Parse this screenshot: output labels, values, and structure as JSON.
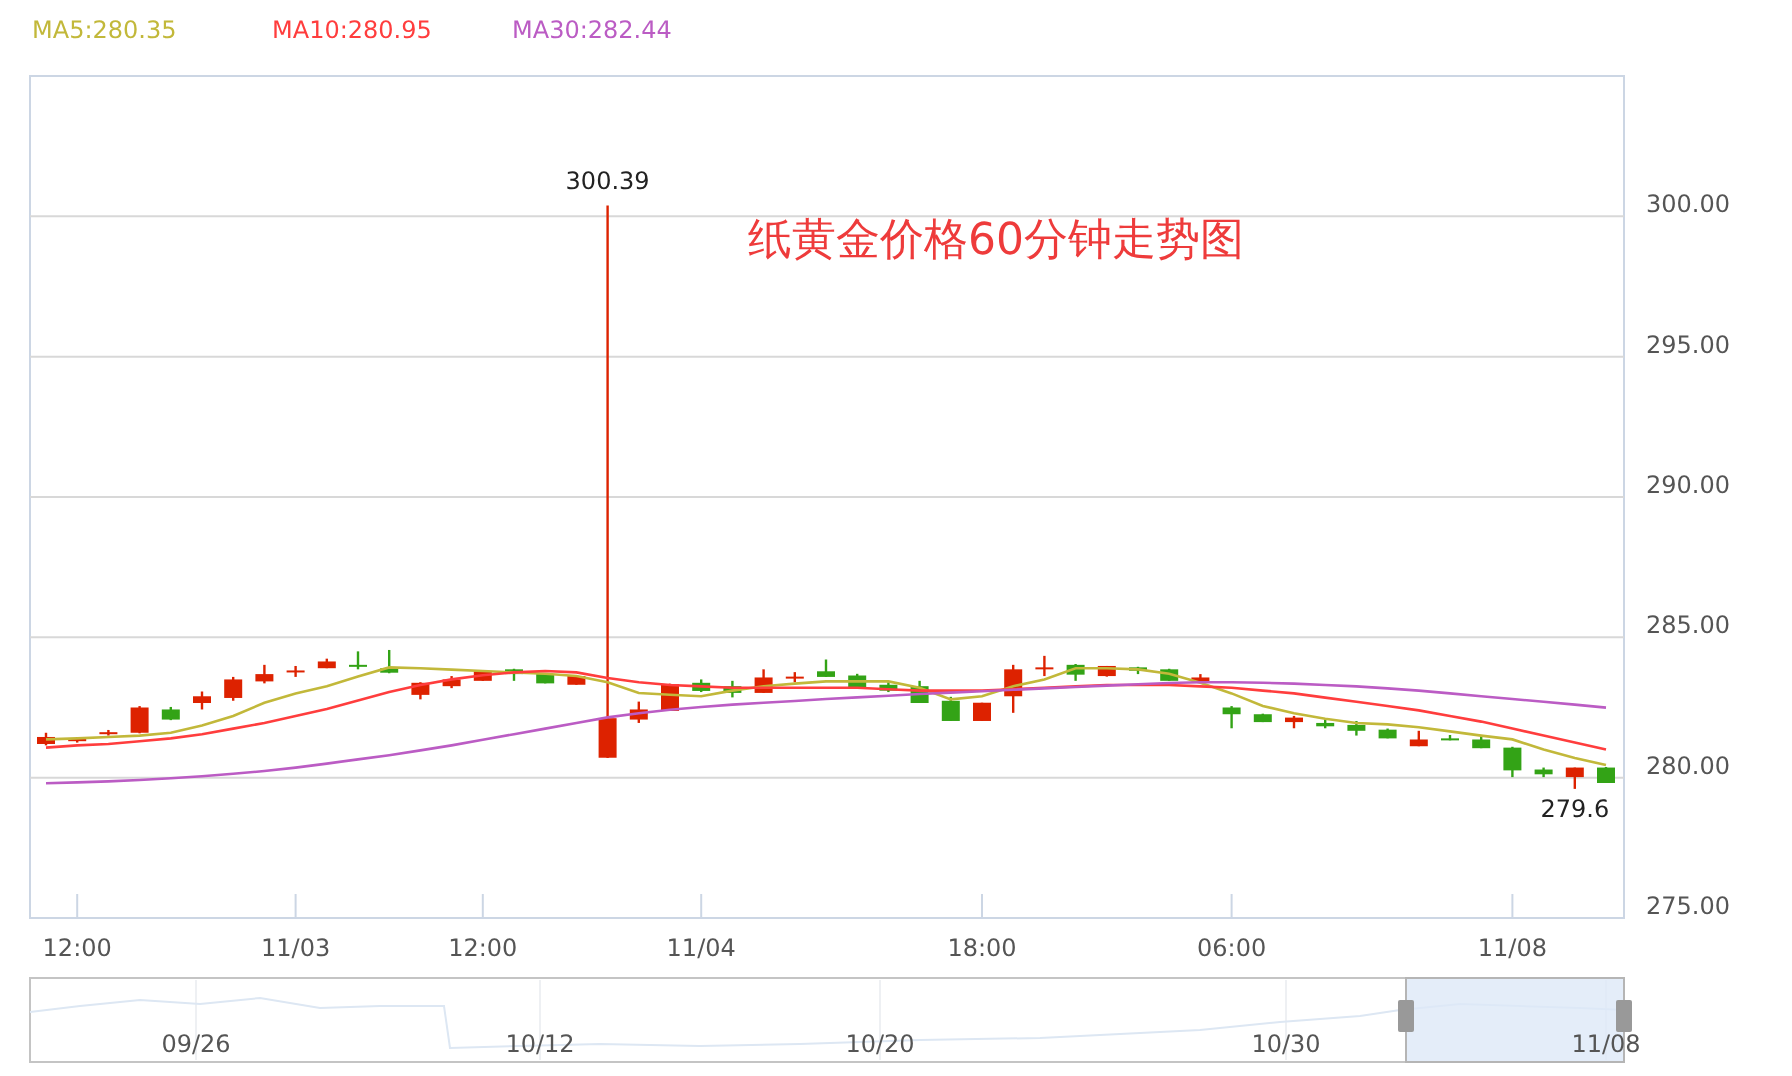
{
  "chart": {
    "chart_data": {
      "type": "candlestick",
      "title": "纸黄金价格60分钟走势图",
      "grid": true,
      "ylim": [
        275,
        305
      ],
      "categories": [
        null,
        "12:00",
        null,
        null,
        null,
        null,
        null,
        null,
        "11/03",
        null,
        null,
        null,
        null,
        null,
        "12:00",
        null,
        null,
        null,
        null,
        null,
        null,
        "11/04",
        null,
        null,
        null,
        null,
        null,
        null,
        null,
        null,
        "18:00",
        null,
        null,
        null,
        null,
        null,
        null,
        null,
        "06:00",
        null,
        null,
        null,
        null,
        null,
        null,
        null,
        null,
        "11/08",
        null,
        null,
        null
      ],
      "yticks": [
        {
          "value": 275,
          "label": "275.00"
        },
        {
          "value": 280,
          "label": "280.00"
        },
        {
          "value": 285,
          "label": "285.00"
        },
        {
          "value": 290,
          "label": "290.00"
        },
        {
          "value": 295,
          "label": "295.00"
        },
        {
          "value": 300,
          "label": "300.00"
        }
      ],
      "series": [
        {
          "name": "MA5:280.35",
          "type": "line",
          "color": "#c2b83a",
          "values": [
            281.36,
            281.4,
            281.45,
            281.5,
            281.6,
            281.86,
            282.2,
            282.67,
            283.0,
            283.26,
            283.6,
            283.93,
            283.9,
            283.85,
            283.8,
            283.75,
            283.7,
            283.62,
            283.4,
            283.02,
            282.95,
            282.9,
            283.1,
            283.26,
            283.35,
            283.43,
            283.43,
            283.43,
            283.2,
            282.79,
            282.9,
            283.26,
            283.5,
            283.9,
            283.9,
            283.86,
            283.7,
            283.38,
            283.0,
            282.55,
            282.3,
            282.1,
            281.95,
            281.9,
            281.8,
            281.65,
            281.5,
            281.36,
            281.0,
            280.7,
            280.45
          ]
        },
        {
          "name": "MA10:280.95",
          "type": "line",
          "color": "#ff3d3d",
          "values": [
            281.07,
            281.15,
            281.2,
            281.3,
            281.4,
            281.55,
            281.75,
            281.95,
            282.2,
            282.45,
            282.75,
            283.05,
            283.3,
            283.5,
            283.65,
            283.75,
            283.8,
            283.75,
            283.55,
            283.4,
            283.3,
            283.25,
            283.2,
            283.2,
            283.2,
            283.2,
            283.2,
            283.15,
            283.1,
            283.1,
            283.1,
            283.15,
            283.2,
            283.25,
            283.3,
            283.3,
            283.3,
            283.25,
            283.2,
            283.1,
            283.0,
            282.85,
            282.7,
            282.55,
            282.4,
            282.2,
            282.0,
            281.75,
            281.5,
            281.25,
            281.0
          ]
        },
        {
          "name": "MA30:282.44",
          "type": "line",
          "color": "#bb5cc4",
          "values": [
            279.8,
            279.83,
            279.87,
            279.92,
            279.98,
            280.05,
            280.14,
            280.24,
            280.36,
            280.5,
            280.65,
            280.8,
            280.97,
            281.15,
            281.35,
            281.55,
            281.75,
            281.95,
            282.15,
            282.3,
            282.42,
            282.52,
            282.6,
            282.67,
            282.73,
            282.8,
            282.86,
            282.92,
            282.98,
            283.03,
            283.08,
            283.13,
            283.18,
            283.23,
            283.28,
            283.33,
            283.37,
            283.4,
            283.4,
            283.38,
            283.35,
            283.3,
            283.25,
            283.18,
            283.1,
            283.0,
            282.9,
            282.8,
            282.7,
            282.6,
            282.5
          ]
        }
      ],
      "ohlc": [
        [
          281.2,
          281.6,
          281.15,
          281.45
        ],
        [
          281.3,
          281.45,
          281.25,
          281.4
        ],
        [
          281.6,
          281.7,
          281.5,
          281.62
        ],
        [
          281.6,
          282.55,
          281.58,
          282.5
        ],
        [
          282.43,
          282.52,
          282.05,
          282.07
        ],
        [
          282.66,
          283.07,
          282.43,
          282.9
        ],
        [
          282.84,
          283.59,
          282.74,
          283.5
        ],
        [
          283.43,
          284.02,
          283.36,
          283.69
        ],
        [
          283.78,
          283.98,
          283.59,
          283.82
        ],
        [
          283.9,
          284.24,
          283.9,
          284.14
        ],
        [
          284.02,
          284.5,
          283.86,
          284.0
        ],
        [
          283.9,
          284.55,
          283.72,
          283.74
        ],
        [
          282.95,
          283.4,
          282.79,
          283.38
        ],
        [
          283.26,
          283.62,
          283.19,
          283.5
        ],
        [
          283.45,
          283.8,
          283.45,
          283.79
        ],
        [
          283.86,
          283.88,
          283.45,
          283.69
        ],
        [
          283.69,
          283.7,
          283.36,
          283.36
        ],
        [
          283.31,
          283.62,
          283.31,
          283.62
        ],
        [
          280.71,
          300.39,
          280.7,
          282.12
        ],
        [
          282.07,
          282.71,
          281.95,
          282.43
        ],
        [
          282.38,
          283.35,
          282.38,
          283.33
        ],
        [
          283.38,
          283.5,
          283.05,
          283.09
        ],
        [
          283.26,
          283.45,
          282.86,
          283.02
        ],
        [
          283.02,
          283.86,
          283.02,
          283.57
        ],
        [
          283.55,
          283.76,
          283.4,
          283.6
        ],
        [
          283.79,
          284.21,
          283.59,
          283.59
        ],
        [
          283.64,
          283.7,
          283.19,
          283.19
        ],
        [
          283.31,
          283.4,
          283.05,
          283.1
        ],
        [
          283.26,
          283.45,
          282.66,
          282.66
        ],
        [
          282.74,
          282.88,
          282.02,
          282.02
        ],
        [
          282.02,
          282.67,
          282.02,
          282.67
        ],
        [
          282.9,
          284.02,
          282.31,
          283.86
        ],
        [
          283.88,
          284.34,
          283.62,
          283.93
        ],
        [
          284.02,
          284.05,
          283.45,
          283.67
        ],
        [
          283.62,
          283.98,
          283.6,
          283.98
        ],
        [
          283.93,
          283.95,
          283.69,
          283.81
        ],
        [
          283.86,
          283.88,
          283.45,
          283.45
        ],
        [
          283.43,
          283.69,
          283.43,
          283.57
        ],
        [
          282.5,
          282.55,
          281.76,
          282.26
        ],
        [
          282.26,
          282.28,
          281.98,
          281.98
        ],
        [
          281.98,
          282.2,
          281.76,
          282.14
        ],
        [
          281.95,
          282.07,
          281.76,
          281.83
        ],
        [
          281.88,
          282.02,
          281.5,
          281.67
        ],
        [
          281.71,
          281.75,
          281.4,
          281.4
        ],
        [
          281.12,
          281.67,
          281.12,
          281.36
        ],
        [
          281.4,
          281.52,
          281.33,
          281.33
        ],
        [
          281.36,
          281.5,
          281.05,
          281.05
        ],
        [
          281.07,
          281.1,
          280.02,
          280.26
        ],
        [
          280.29,
          280.36,
          280.02,
          280.12
        ],
        [
          280.02,
          280.36,
          279.6,
          280.36
        ],
        [
          280.36,
          280.38,
          279.81,
          279.81
        ]
      ],
      "annotations": [
        "300.39",
        "279.6"
      ]
    }
  },
  "navigator": {
    "labels": [
      "09/26",
      "10/12",
      "10/20",
      "10/30",
      "11/08"
    ]
  }
}
